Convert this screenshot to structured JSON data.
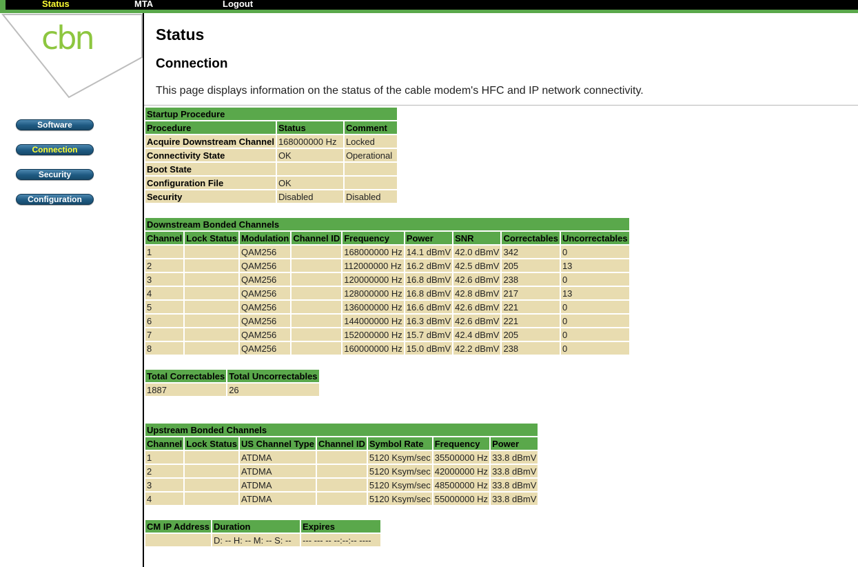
{
  "topnav": {
    "status": "Status",
    "mta": "MTA",
    "logout": "Logout"
  },
  "logo": {
    "text": "cbn"
  },
  "sidebar": {
    "software": "Software",
    "connection": "Connection",
    "security": "Security",
    "configuration": "Configuration"
  },
  "header": {
    "title": "Status",
    "section": "Connection",
    "description": "This page displays information on the status of the cable modem's HFC and IP network connectivity."
  },
  "startup": {
    "caption": "Startup Procedure",
    "columns": [
      "Procedure",
      "Status",
      "Comment"
    ],
    "rows": [
      [
        "Acquire Downstream Channel",
        "168000000 Hz",
        "Locked"
      ],
      [
        "Connectivity State",
        "OK",
        "Operational"
      ],
      [
        "Boot State",
        "",
        ""
      ],
      [
        "Configuration File",
        "OK",
        ""
      ],
      [
        "Security",
        "Disabled",
        "Disabled"
      ]
    ]
  },
  "downstream": {
    "caption": "Downstream Bonded Channels",
    "columns": [
      "Channel",
      "Lock Status",
      "Modulation",
      "Channel ID",
      "Frequency",
      "Power",
      "SNR",
      "Correctables",
      "Uncorrectables"
    ],
    "rows": [
      [
        "1",
        "",
        "QAM256",
        "",
        "168000000 Hz",
        "14.1 dBmV",
        "42.0 dBmV",
        "342",
        "0"
      ],
      [
        "2",
        "",
        "QAM256",
        "",
        "112000000 Hz",
        "16.2 dBmV",
        "42.5 dBmV",
        "205",
        "13"
      ],
      [
        "3",
        "",
        "QAM256",
        "",
        "120000000 Hz",
        "16.8 dBmV",
        "42.6 dBmV",
        "238",
        "0"
      ],
      [
        "4",
        "",
        "QAM256",
        "",
        "128000000 Hz",
        "16.8 dBmV",
        "42.8 dBmV",
        "217",
        "13"
      ],
      [
        "5",
        "",
        "QAM256",
        "",
        "136000000 Hz",
        "16.6 dBmV",
        "42.6 dBmV",
        "221",
        "0"
      ],
      [
        "6",
        "",
        "QAM256",
        "",
        "144000000 Hz",
        "16.3 dBmV",
        "42.6 dBmV",
        "221",
        "0"
      ],
      [
        "7",
        "",
        "QAM256",
        "",
        "152000000 Hz",
        "15.7 dBmV",
        "42.4 dBmV",
        "205",
        "0"
      ],
      [
        "8",
        "",
        "QAM256",
        "",
        "160000000 Hz",
        "15.0 dBmV",
        "42.2 dBmV",
        "238",
        "0"
      ]
    ]
  },
  "totals": {
    "columns": [
      "Total Correctables",
      "Total Uncorrectables"
    ],
    "values": [
      "1887",
      "26"
    ]
  },
  "upstream": {
    "caption": "Upstream Bonded Channels",
    "columns": [
      "Channel",
      "Lock Status",
      "US Channel Type",
      "Channel ID",
      "Symbol Rate",
      "Frequency",
      "Power"
    ],
    "rows": [
      [
        "1",
        "",
        "ATDMA",
        "",
        "5120 Ksym/sec",
        "35500000 Hz",
        "33.8 dBmV"
      ],
      [
        "2",
        "",
        "ATDMA",
        "",
        "5120 Ksym/sec",
        "42000000 Hz",
        "33.8 dBmV"
      ],
      [
        "3",
        "",
        "ATDMA",
        "",
        "5120 Ksym/sec",
        "48500000 Hz",
        "33.8 dBmV"
      ],
      [
        "4",
        "",
        "ATDMA",
        "",
        "5120 Ksym/sec",
        "55000000 Hz",
        "33.8 dBmV"
      ]
    ]
  },
  "cmip": {
    "columns": [
      "CM IP Address",
      "Duration",
      "Expires"
    ],
    "values": [
      "",
      "D: -- H: -- M: -- S: --",
      "--- --- -- --:--:-- ----"
    ]
  }
}
